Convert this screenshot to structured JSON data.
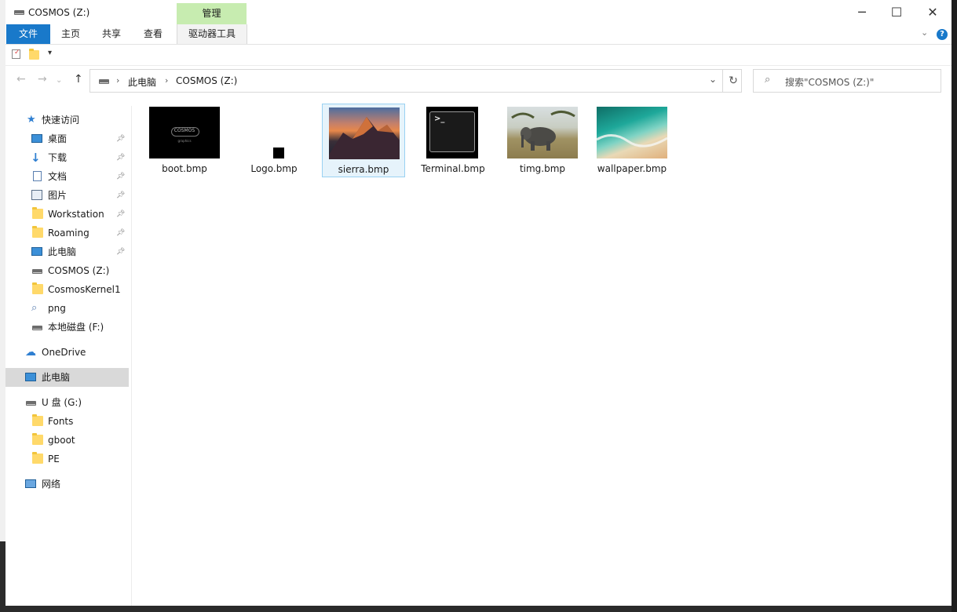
{
  "window": {
    "title": "COSMOS (Z:)",
    "contextual_group": "管理",
    "controls": {
      "minimize": "─",
      "maximize": "☐",
      "close": "✕"
    }
  },
  "ribbon": {
    "tabs": [
      "文件",
      "主页",
      "共享",
      "查看",
      "驱动器工具"
    ],
    "help": "?"
  },
  "address_bar": {
    "crumbs": [
      "此电脑",
      "COSMOS (Z:)"
    ],
    "search_placeholder": "搜索\"COSMOS (Z:)\""
  },
  "nav_pane": {
    "quick_access": "快速访问",
    "items": [
      "桌面",
      "下载",
      "文档",
      "图片",
      "Workstation",
      "Roaming",
      "此电脑",
      "COSMOS (Z:)",
      "CosmosKernel1",
      "png",
      "本地磁盘 (F:)",
      "OneDrive",
      "此电脑",
      "U 盘 (G:)",
      "Fonts",
      "gboot",
      "PE",
      "网络"
    ]
  },
  "files": [
    {
      "name": "boot.bmp"
    },
    {
      "name": "Logo.bmp"
    },
    {
      "name": "sierra.bmp"
    },
    {
      "name": "Terminal.bmp"
    },
    {
      "name": "timg.bmp"
    },
    {
      "name": "wallpaper.bmp"
    }
  ],
  "thumb_text": {
    "boot_logo": "COSMOS",
    "boot_sub": "graphics",
    "terminal_prompt": ">_"
  },
  "colors": {
    "accent": "#1979ca",
    "contextual_tab": "#c7ecb0",
    "selection": "#e6f3fb",
    "selection_border": "#99d1f2"
  }
}
